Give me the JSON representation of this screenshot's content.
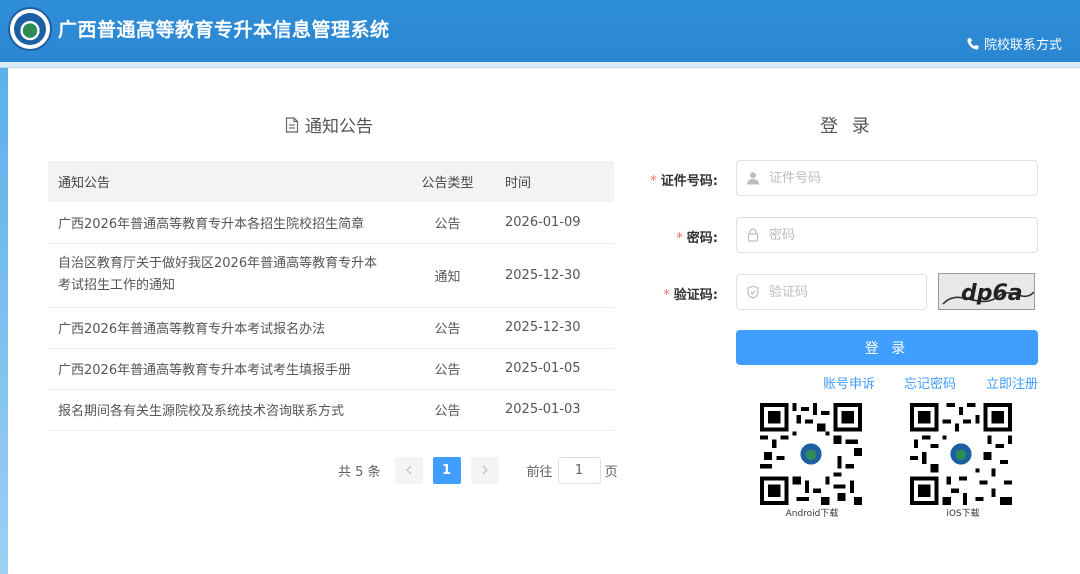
{
  "header": {
    "title": "广西普通高等教育专升本信息管理系统",
    "contact_label": "院校联系方式",
    "logo_icon": "school-emblem-icon",
    "phone_icon": "phone-icon"
  },
  "notice": {
    "title": "通知公告",
    "title_icon": "document-icon",
    "columns": [
      "通知公告",
      "公告类型",
      "时间"
    ],
    "rows": [
      {
        "title": "广西2026年普通高等教育专升本各招生院校招生简章",
        "type": "公告",
        "date": "2026-01-09"
      },
      {
        "title": "自治区教育厅关于做好我区2026年普通高等教育专升本考试招生工作的通知",
        "type": "通知",
        "date": "2025-12-30"
      },
      {
        "title": "广西2026年普通高等教育专升本考试报名办法",
        "type": "公告",
        "date": "2025-12-30"
      },
      {
        "title": "广西2026年普通高等教育专升本考试考生填报手册",
        "type": "公告",
        "date": "2025-01-05"
      },
      {
        "title": "报名期间各有关生源院校及系统技术咨询联系方式",
        "type": "公告",
        "date": "2025-01-03"
      }
    ]
  },
  "pagination": {
    "total_label": "共 5 条",
    "current_page": "1",
    "goto_label": "前往",
    "goto_value": "1",
    "page_suffix": "页",
    "prev_icon": "chevron-left-icon",
    "next_icon": "chevron-right-icon"
  },
  "login": {
    "title": "登 录",
    "id_label": "证件号码:",
    "id_placeholder": "证件号码",
    "password_label": "密码:",
    "password_placeholder": "密码",
    "captcha_label": "验证码:",
    "captcha_placeholder": "验证码",
    "captcha_text": "dp6a",
    "required_mark": "*",
    "submit_label": "登 录",
    "links": {
      "appeal": "账号申诉",
      "forgot": "忘记密码",
      "register": "立即注册"
    }
  },
  "downloads": {
    "android_label": "Android下载",
    "ios_label": "iOS下载"
  },
  "colors": {
    "header": "#2f8fd8",
    "primary": "#409eff",
    "required": "#f56c6c"
  }
}
